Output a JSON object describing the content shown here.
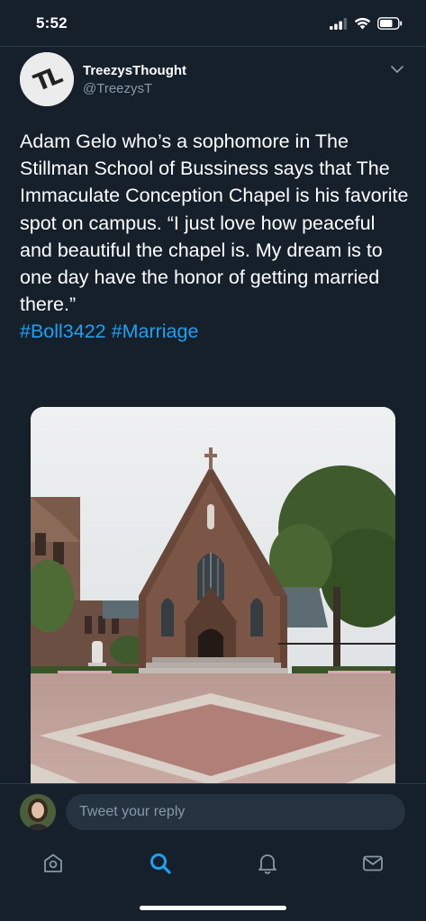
{
  "status_bar": {
    "time": "5:52"
  },
  "tweet": {
    "avatar_text": "TL",
    "display_name": "TreezysThought",
    "handle": "@TreezysT",
    "body_text": "Adam Gelo who’s a sophomore in The Stillman School of Bussiness says that The Immaculate Conception Chapel is his favorite spot on campus. “I just love how peaceful and beautiful the chapel is. My dream is to one day have the honor of getting married there.”",
    "hashtags": [
      "#Boll3422",
      "#Marriage"
    ],
    "image": {
      "subject": "chapel"
    }
  },
  "reply": {
    "placeholder": "Tweet your reply"
  },
  "nav": {
    "items": [
      "home-icon",
      "search-icon",
      "notifications-icon",
      "messages-icon"
    ],
    "active": "search-icon"
  },
  "colors": {
    "background": "#15202b",
    "accent": "#1da1f2",
    "secondary_text": "#8899a6"
  }
}
